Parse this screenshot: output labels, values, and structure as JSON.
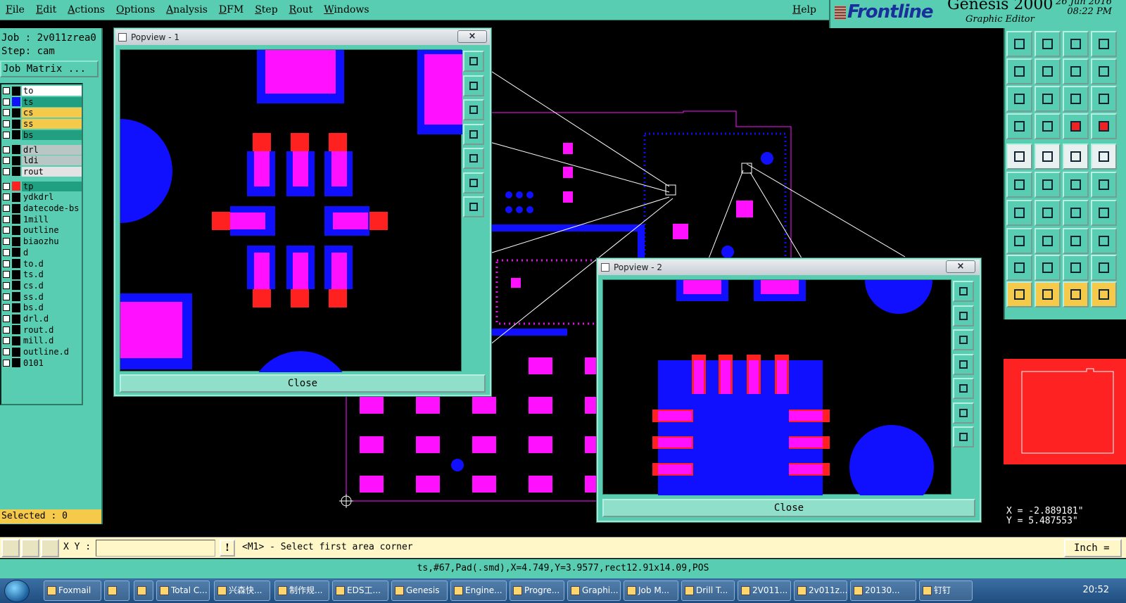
{
  "menubar": {
    "items": [
      "File",
      "Edit",
      "Actions",
      "Options",
      "Analysis",
      "DFM",
      "Step",
      "Rout",
      "Windows"
    ],
    "help": "Help"
  },
  "brand": {
    "logo": "Frontline",
    "product": "Genesis 2000",
    "subtitle": "Graphic Editor",
    "date": "26 Jun 2016",
    "time": "08:22 PM"
  },
  "job": {
    "job_label": "Job : 2v011zrea0",
    "step_label": "Step: cam",
    "matrix_button": "Job Matrix ..."
  },
  "layers": [
    {
      "name": "to",
      "color": "#ffffff",
      "swatch": "#000000"
    },
    {
      "name": "ts",
      "color": "#20a080",
      "swatch": "#1010ff"
    },
    {
      "name": "cs",
      "color": "#f5c94a",
      "swatch": "#000000"
    },
    {
      "name": "ss",
      "color": "#f5c94a",
      "swatch": "#000000"
    },
    {
      "name": "bs",
      "color": "#20a080",
      "swatch": "#000000"
    },
    {
      "name": "drl",
      "color": "#b9c7c4",
      "swatch": "#000000"
    },
    {
      "name": "ldi",
      "color": "#b9c7c4",
      "swatch": "#000000"
    },
    {
      "name": "rout",
      "color": "#e3e3e3",
      "swatch": "#000000"
    },
    {
      "name": "tp",
      "color": "#20a080",
      "swatch": "#ff2020"
    },
    {
      "name": "ydkdrl",
      "color": "#58cdb1",
      "swatch": "#000000"
    },
    {
      "name": "datecode-bs",
      "color": "#58cdb1",
      "swatch": "#000000"
    },
    {
      "name": "1mill",
      "color": "#58cdb1",
      "swatch": "#000000"
    },
    {
      "name": "outline",
      "color": "#58cdb1",
      "swatch": "#000000"
    },
    {
      "name": "biaozhu",
      "color": "#58cdb1",
      "swatch": "#000000"
    },
    {
      "name": "d",
      "color": "#58cdb1",
      "swatch": "#000000"
    },
    {
      "name": "to.d",
      "color": "#58cdb1",
      "swatch": "#000000"
    },
    {
      "name": "ts.d",
      "color": "#58cdb1",
      "swatch": "#000000"
    },
    {
      "name": "cs.d",
      "color": "#58cdb1",
      "swatch": "#000000"
    },
    {
      "name": "ss.d",
      "color": "#58cdb1",
      "swatch": "#000000"
    },
    {
      "name": "bs.d",
      "color": "#58cdb1",
      "swatch": "#000000"
    },
    {
      "name": "drl.d",
      "color": "#58cdb1",
      "swatch": "#000000"
    },
    {
      "name": "rout.d",
      "color": "#58cdb1",
      "swatch": "#000000"
    },
    {
      "name": "mill.d",
      "color": "#58cdb1",
      "swatch": "#000000"
    },
    {
      "name": "outline.d",
      "color": "#58cdb1",
      "swatch": "#000000"
    },
    {
      "name": "0101",
      "color": "#58cdb1",
      "swatch": "#000000"
    }
  ],
  "selected": "Selected : 0",
  "popview1": {
    "title": "Popview - 1",
    "close": "Close",
    "x": "×"
  },
  "popview2": {
    "title": "Popview - 2",
    "close": "Close",
    "x": "×"
  },
  "coords": {
    "x": "X = -2.889181\"",
    "y": "Y = 5.487553\""
  },
  "command": {
    "xy_label": "X Y :",
    "xy_value": "",
    "warn": "!",
    "prompt": "<M1> - Select first area corner",
    "units": "Inch"
  },
  "status": "ts,#67,Pad(.smd),X=4.749,Y=3.9577,rect12.91x14.09,POS",
  "taskbar": {
    "tasks": [
      "Foxmail",
      "",
      "",
      "Total C...",
      "兴森快...",
      "制作规...",
      "EDS工...",
      "Genesis",
      "Engine...",
      "Progre...",
      "Graphi...",
      "Job M...",
      "Drill T...",
      "2V011...",
      "2v011z...",
      "20130...",
      "钉钉"
    ],
    "clock": "20:52"
  },
  "colors": {
    "panel": "#58cdb1",
    "pad": "#ff10ff",
    "copper": "#1010ff",
    "red": "#ff2020"
  }
}
